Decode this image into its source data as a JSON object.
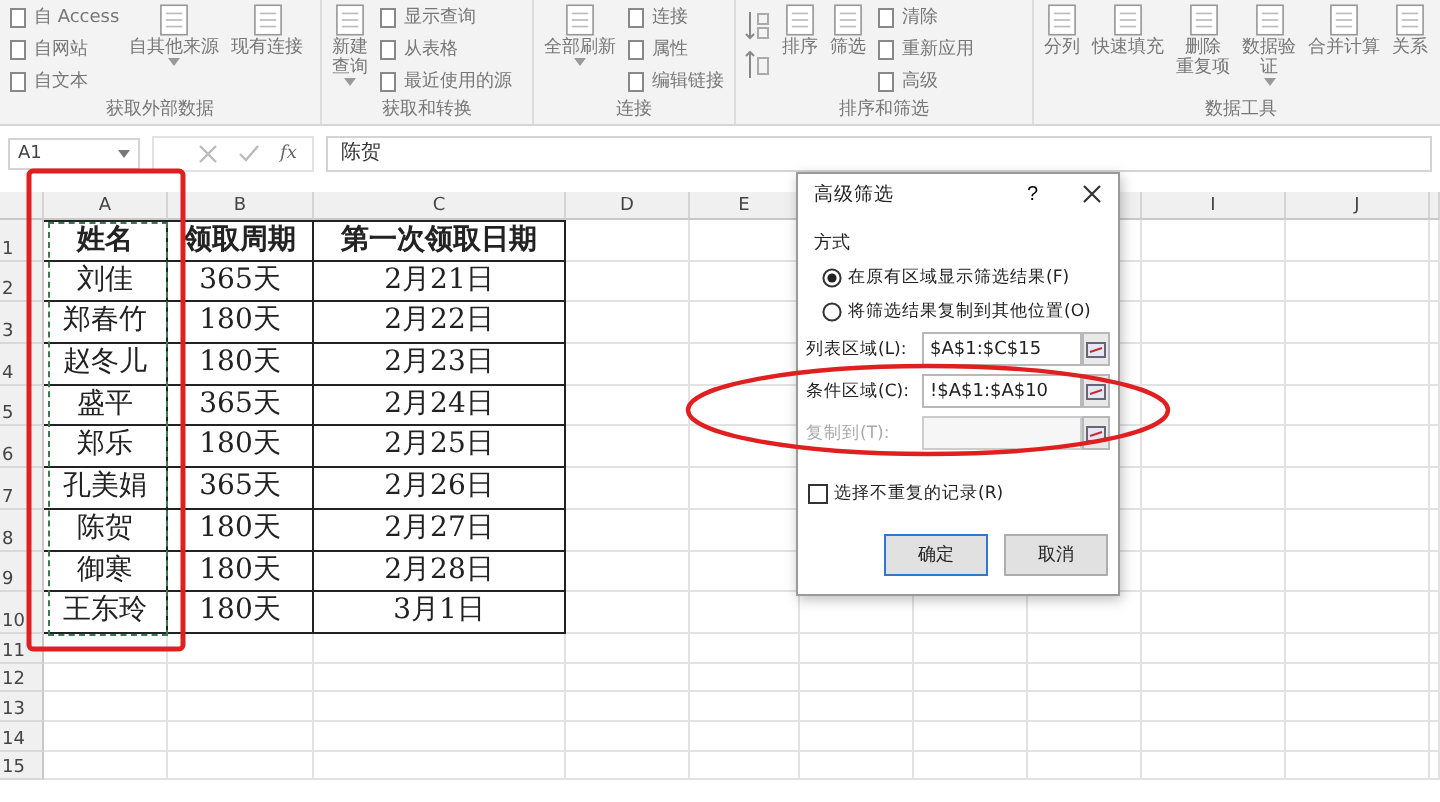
{
  "ribbon": {
    "groups": [
      {
        "label": "获取外部数据",
        "items": [
          {
            "kind": "stack",
            "entries": [
              "自 Access",
              "自网站",
              "自文本"
            ]
          },
          {
            "kind": "large",
            "lines": [
              "自其他来源"
            ],
            "dropdown": true
          },
          {
            "kind": "large",
            "lines": [
              "现有连接"
            ],
            "dropdown": false
          }
        ]
      },
      {
        "label": "获取和转换",
        "items": [
          {
            "kind": "large",
            "lines": [
              "新建",
              "查询"
            ],
            "dropdown": true
          },
          {
            "kind": "stack",
            "entries": [
              "显示查询",
              "从表格",
              "最近使用的源"
            ]
          }
        ]
      },
      {
        "label": "连接",
        "items": [
          {
            "kind": "large",
            "lines": [
              "全部刷新"
            ],
            "dropdown": true
          },
          {
            "kind": "stack",
            "entries": [
              "连接",
              "属性",
              "编辑链接"
            ]
          }
        ]
      },
      {
        "label": "排序和筛选",
        "items": [
          {
            "kind": "sort"
          },
          {
            "kind": "large",
            "lines": [
              "排序"
            ],
            "dropdown": false
          },
          {
            "kind": "large",
            "lines": [
              "筛选"
            ],
            "dropdown": false
          },
          {
            "kind": "stack",
            "entries": [
              "清除",
              "重新应用",
              "高级"
            ]
          }
        ]
      },
      {
        "label": "数据工具",
        "items": [
          {
            "kind": "large",
            "lines": [
              "分列"
            ],
            "dropdown": false
          },
          {
            "kind": "large",
            "lines": [
              "快速填充"
            ],
            "dropdown": false
          },
          {
            "kind": "large",
            "lines": [
              "删除",
              "重复项"
            ],
            "dropdown": false
          },
          {
            "kind": "large",
            "lines": [
              "数据验",
              "证"
            ],
            "dropdown": true
          },
          {
            "kind": "large",
            "lines": [
              "合并计算"
            ],
            "dropdown": false
          },
          {
            "kind": "large",
            "lines": [
              "关系"
            ],
            "dropdown": false
          }
        ]
      }
    ]
  },
  "formula_bar": {
    "name_box": "A1",
    "function_label": "fx",
    "value": "陈贺"
  },
  "sheet": {
    "columns": [
      "A",
      "B",
      "C",
      "D",
      "E",
      "I",
      "J"
    ],
    "rows": [
      {
        "number": "1",
        "cells": [
          "姓名",
          "领取周期",
          "第一次领取日期"
        ]
      },
      {
        "number": "2",
        "cells": [
          "刘佳",
          "365天",
          "2月21日"
        ]
      },
      {
        "number": "3",
        "cells": [
          "郑春竹",
          "180天",
          "2月22日"
        ]
      },
      {
        "number": "4",
        "cells": [
          "赵冬儿",
          "180天",
          "2月23日"
        ]
      },
      {
        "number": "5",
        "cells": [
          "盛平",
          "365天",
          "2月24日"
        ]
      },
      {
        "number": "6",
        "cells": [
          "郑乐",
          "180天",
          "2月25日"
        ]
      },
      {
        "number": "7",
        "cells": [
          "孔美娟",
          "365天",
          "2月26日"
        ]
      },
      {
        "number": "8",
        "cells": [
          "陈贺",
          "180天",
          "2月27日"
        ]
      },
      {
        "number": "9",
        "cells": [
          "御寒",
          "180天",
          "2月28日"
        ]
      },
      {
        "number": "10",
        "cells": [
          "王东玲",
          "180天",
          "3月1日"
        ]
      },
      {
        "number": "11"
      },
      {
        "number": "12"
      },
      {
        "number": "13"
      },
      {
        "number": "14"
      },
      {
        "number": "15"
      }
    ]
  },
  "dialog": {
    "title": "高级筛选",
    "help": "?",
    "group_label": "方式",
    "options": [
      {
        "label": "在原有区域显示筛选结果(F)",
        "selected": true
      },
      {
        "label": "将筛选结果复制到其他位置(O)",
        "selected": false
      }
    ],
    "fields": [
      {
        "label": "列表区域(L):",
        "value": "$A$1:$C$15",
        "disabled": false
      },
      {
        "label": "条件区域(C):",
        "value": "!$A$1:$A$10",
        "disabled": false
      },
      {
        "label": "复制到(T):",
        "disabled": true
      }
    ],
    "checkbox": {
      "label": "选择不重复的记录(R)",
      "checked": false
    },
    "buttons": [
      {
        "label": "确定",
        "default": true
      },
      {
        "label": "取消",
        "default": false
      }
    ]
  }
}
